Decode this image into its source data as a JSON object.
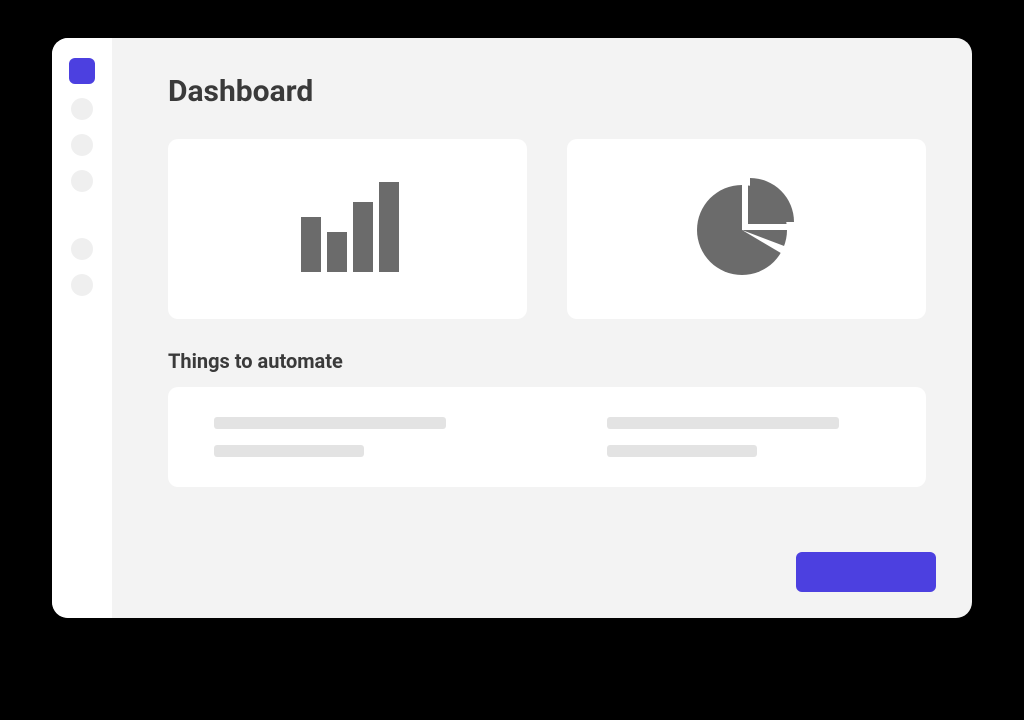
{
  "page": {
    "title": "Dashboard"
  },
  "sections": {
    "automate_title": "Things to automate"
  },
  "colors": {
    "accent": "#4c40e0",
    "icon_fill": "#6b6b6b"
  }
}
